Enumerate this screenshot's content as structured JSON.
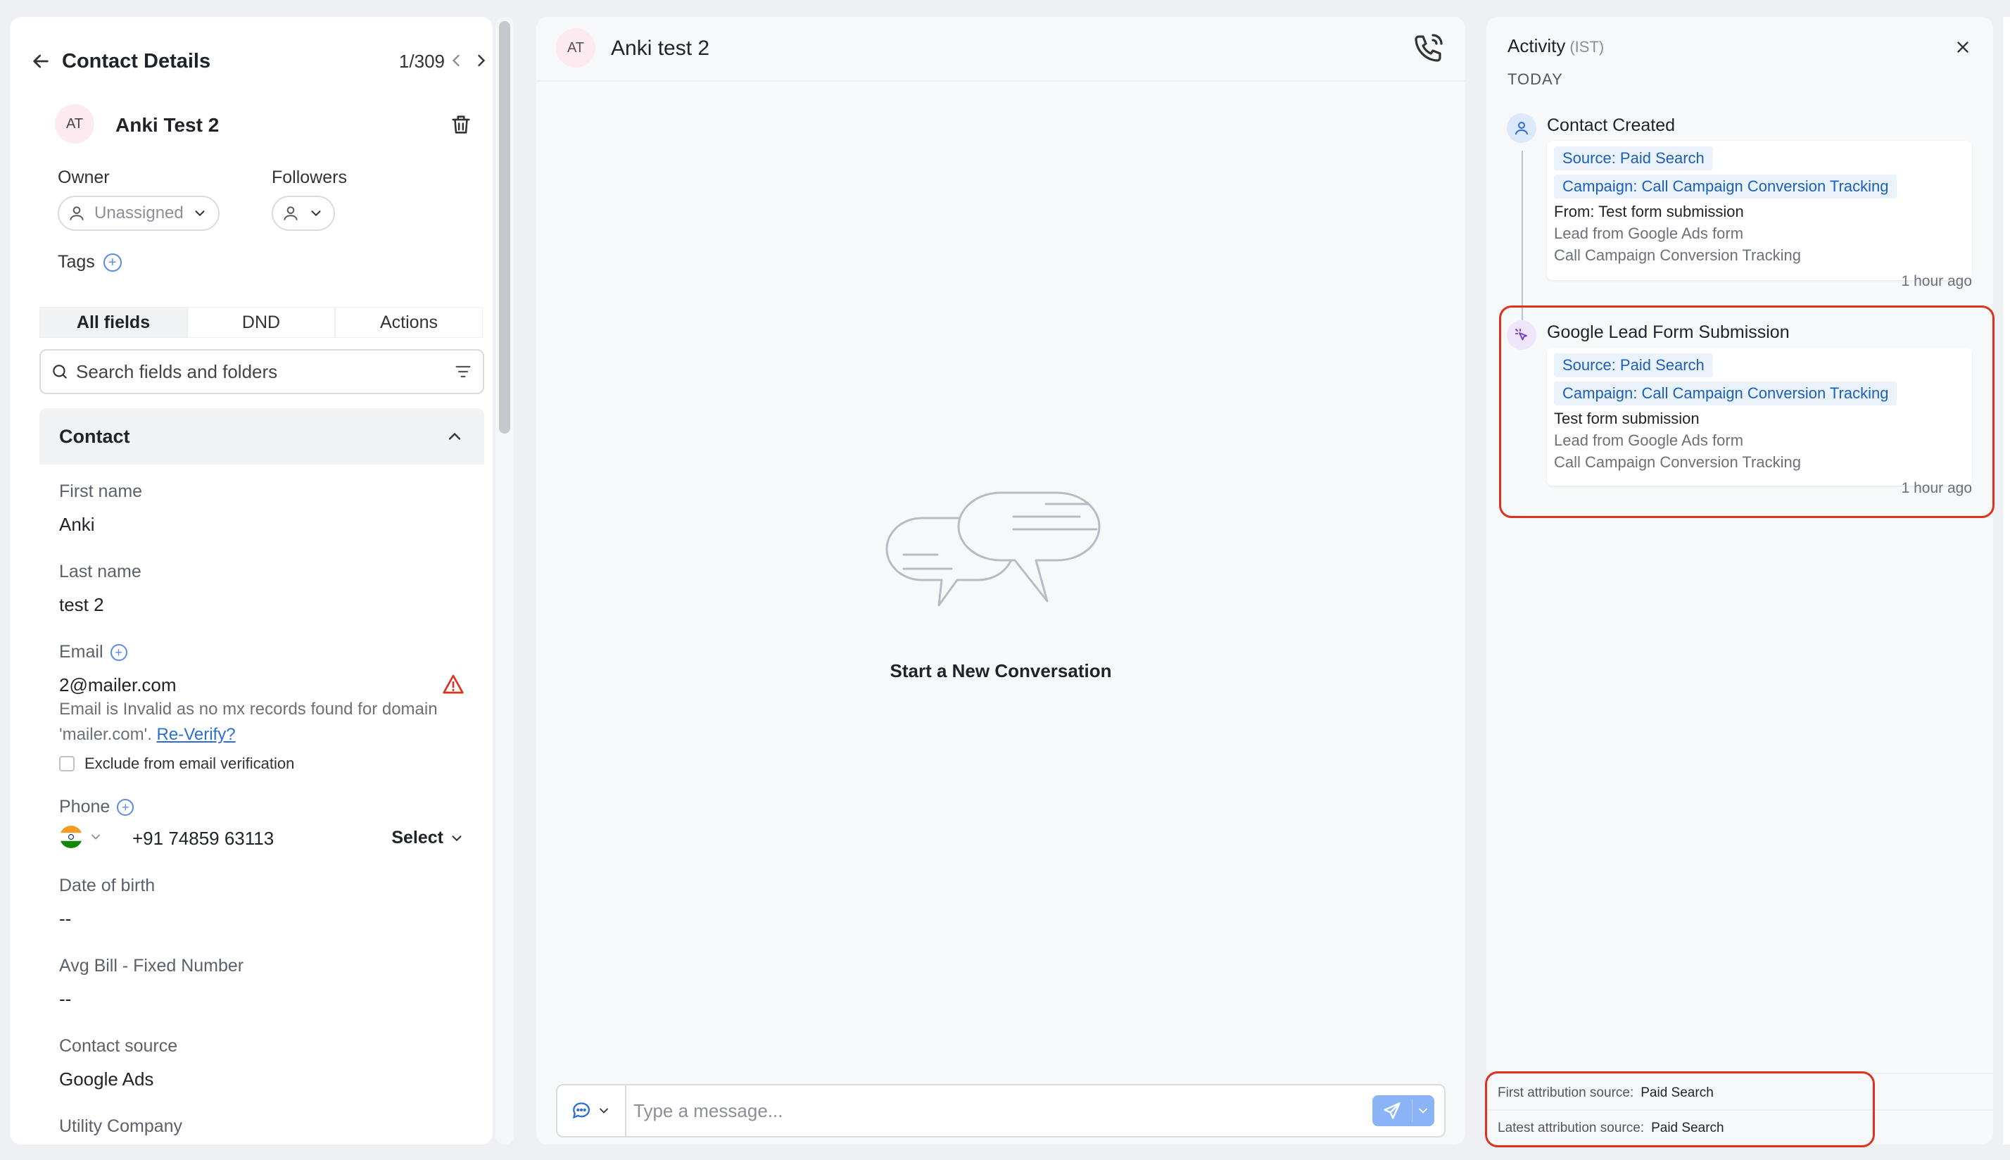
{
  "left": {
    "title": "Contact Details",
    "counter": "1/309",
    "contact": {
      "initials": "AT",
      "name": "Anki Test 2",
      "owner_label": "Owner",
      "owner_value": "Unassigned",
      "followers_label": "Followers",
      "tags_label": "Tags"
    },
    "tabs": [
      {
        "label": "All fields",
        "active": true
      },
      {
        "label": "DND",
        "active": false
      },
      {
        "label": "Actions",
        "active": false
      }
    ],
    "search_placeholder": "Search fields and folders",
    "section_title": "Contact",
    "fields": {
      "first_name_label": "First name",
      "first_name_value": "Anki",
      "last_name_label": "Last name",
      "last_name_value": "test 2",
      "email_label": "Email",
      "email_value": "2@mailer.com",
      "email_error_a": "Email is Invalid as no mx records found for domain",
      "email_error_b": "'mailer.com'.",
      "reverify_link": "Re-Verify?",
      "exclude_label": "Exclude from email verification",
      "phone_label": "Phone",
      "phone_value": "+91 74859 63113",
      "phone_type": "Select",
      "dob_label": "Date of birth",
      "dob_value": "--",
      "avg_bill_label": "Avg Bill - Fixed Number",
      "avg_bill_value": "--",
      "contact_source_label": "Contact source",
      "contact_source_value": "Google Ads",
      "utility_label": "Utility Company",
      "utility_value": "--"
    }
  },
  "middle": {
    "initials": "AT",
    "name": "Anki test 2",
    "empty_title": "Start a New Conversation",
    "composer_placeholder": "Type a message..."
  },
  "right": {
    "title": "Activity",
    "tz": "(IST)",
    "today": "TODAY",
    "activities": [
      {
        "title": "Contact Created",
        "source_chip": "Source: Paid Search",
        "campaign_chip": "Campaign: Call Campaign Conversion Tracking",
        "line1": "From: Test form submission",
        "line2": "Lead from Google Ads form",
        "line3": "Call Campaign Conversion Tracking",
        "time": "1 hour ago"
      },
      {
        "title": "Google Lead Form Submission",
        "source_chip": "Source: Paid Search",
        "campaign_chip": "Campaign: Call Campaign Conversion Tracking",
        "line1": "Test form submission",
        "line2": "Lead from Google Ads form",
        "line3": "Call Campaign Conversion Tracking",
        "time": "1 hour ago"
      }
    ],
    "attribution": {
      "first_label": "First attribution source:",
      "first_value": "Paid Search",
      "latest_label": "Latest attribution source:",
      "latest_value": "Paid Search"
    }
  },
  "colors": {
    "accent": "#2b6fd6",
    "highlight": "#e0301e",
    "avatar_bg": "#fdeaf0",
    "chip_bg": "#eaf2fc",
    "chip_text": "#1d5fb8",
    "send_btn": "#8ab4f5",
    "warning": "#e0301e"
  },
  "icons": [
    "back-arrow-icon",
    "chevron-left-icon",
    "chevron-right-icon",
    "trash-icon",
    "user-icon",
    "chevron-down-icon",
    "plus-icon",
    "search-icon",
    "filter-icon",
    "chevron-up-icon",
    "warning-icon",
    "india-flag-icon",
    "phone-call-icon",
    "chat-bubbles-illustration",
    "message-type-icon",
    "send-icon",
    "close-icon",
    "activity-user-icon",
    "cursor-click-icon"
  ]
}
